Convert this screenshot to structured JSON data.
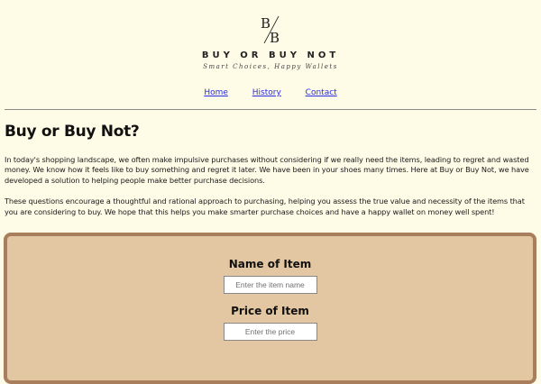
{
  "header": {
    "logo_letters": {
      "first": "B",
      "second": "B"
    },
    "brand_name": "BUY OR BUY NOT",
    "tagline": "Smart Choices, Happy Wallets"
  },
  "nav": {
    "items": [
      {
        "label": "Home"
      },
      {
        "label": "History"
      },
      {
        "label": "Contact"
      }
    ]
  },
  "main": {
    "title": "Buy or Buy Not?",
    "paragraphs": [
      "In today's shopping landscape, we often make impulsive purchases without considering if we really need the items, leading to regret and wasted money. We know how it feels like to buy something and regret it later. We have been in your shoes many times. Here at Buy or Buy Not, we have developed a solution to helping people make better purchase decisions.",
      "These questions encourage a thoughtful and rational approach to purchasing, helping you assess the true value and necessity of the items that you are considering to buy. We hope that this helps you make smarter purchase choices and have a happy wallet on money well spent!"
    ]
  },
  "form": {
    "name_label": "Name of Item",
    "name_placeholder": "Enter the item name",
    "price_label": "Price of Item",
    "price_placeholder": "Enter the price"
  },
  "colors": {
    "background": "#fefbe6",
    "panel_fill": "#e3c7a2",
    "panel_border": "#a87e5c",
    "link": "#2a2ae0"
  }
}
